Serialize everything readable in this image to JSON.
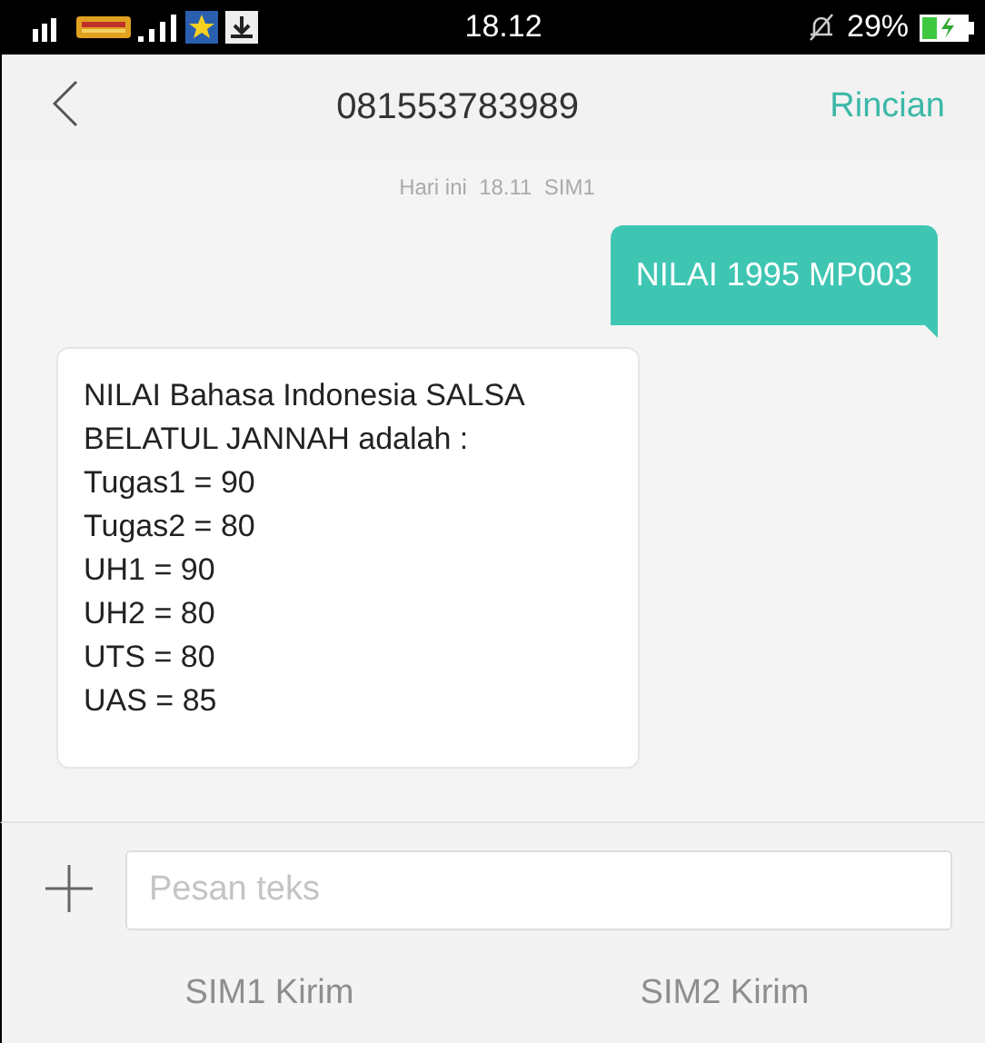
{
  "status_bar": {
    "time": "18.12",
    "battery_percent": "29%"
  },
  "header": {
    "title": "081553783989",
    "action": "Rincian"
  },
  "thread": {
    "date_label": "Hari ini  18.11  SIM1",
    "messages": [
      {
        "kind": "sent",
        "text": "NILAI 1995 MP003"
      },
      {
        "kind": "received",
        "text": "NILAI Bahasa Indonesia SALSA\nBELATUL JANNAH adalah :\nTugas1 = 90\nTugas2 = 80\nUH1 = 90\nUH2 = 80\nUTS = 80\nUAS = 85"
      }
    ]
  },
  "compose": {
    "placeholder": "Pesan teks",
    "send_buttons": [
      {
        "label": "SIM1 Kirim",
        "disabled": true
      },
      {
        "label": "SIM2 Kirim",
        "disabled": true
      }
    ]
  }
}
